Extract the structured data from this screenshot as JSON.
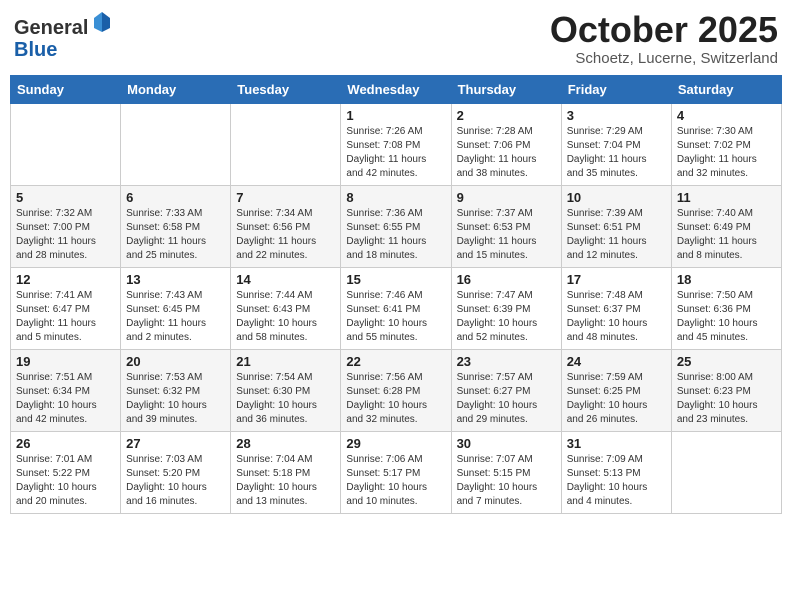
{
  "header": {
    "logo_general": "General",
    "logo_blue": "Blue",
    "month_title": "October 2025",
    "subtitle": "Schoetz, Lucerne, Switzerland"
  },
  "days_of_week": [
    "Sunday",
    "Monday",
    "Tuesday",
    "Wednesday",
    "Thursday",
    "Friday",
    "Saturday"
  ],
  "weeks": [
    [
      {
        "day": "",
        "info": ""
      },
      {
        "day": "",
        "info": ""
      },
      {
        "day": "",
        "info": ""
      },
      {
        "day": "1",
        "info": "Sunrise: 7:26 AM\nSunset: 7:08 PM\nDaylight: 11 hours and 42 minutes."
      },
      {
        "day": "2",
        "info": "Sunrise: 7:28 AM\nSunset: 7:06 PM\nDaylight: 11 hours and 38 minutes."
      },
      {
        "day": "3",
        "info": "Sunrise: 7:29 AM\nSunset: 7:04 PM\nDaylight: 11 hours and 35 minutes."
      },
      {
        "day": "4",
        "info": "Sunrise: 7:30 AM\nSunset: 7:02 PM\nDaylight: 11 hours and 32 minutes."
      }
    ],
    [
      {
        "day": "5",
        "info": "Sunrise: 7:32 AM\nSunset: 7:00 PM\nDaylight: 11 hours and 28 minutes."
      },
      {
        "day": "6",
        "info": "Sunrise: 7:33 AM\nSunset: 6:58 PM\nDaylight: 11 hours and 25 minutes."
      },
      {
        "day": "7",
        "info": "Sunrise: 7:34 AM\nSunset: 6:56 PM\nDaylight: 11 hours and 22 minutes."
      },
      {
        "day": "8",
        "info": "Sunrise: 7:36 AM\nSunset: 6:55 PM\nDaylight: 11 hours and 18 minutes."
      },
      {
        "day": "9",
        "info": "Sunrise: 7:37 AM\nSunset: 6:53 PM\nDaylight: 11 hours and 15 minutes."
      },
      {
        "day": "10",
        "info": "Sunrise: 7:39 AM\nSunset: 6:51 PM\nDaylight: 11 hours and 12 minutes."
      },
      {
        "day": "11",
        "info": "Sunrise: 7:40 AM\nSunset: 6:49 PM\nDaylight: 11 hours and 8 minutes."
      }
    ],
    [
      {
        "day": "12",
        "info": "Sunrise: 7:41 AM\nSunset: 6:47 PM\nDaylight: 11 hours and 5 minutes."
      },
      {
        "day": "13",
        "info": "Sunrise: 7:43 AM\nSunset: 6:45 PM\nDaylight: 11 hours and 2 minutes."
      },
      {
        "day": "14",
        "info": "Sunrise: 7:44 AM\nSunset: 6:43 PM\nDaylight: 10 hours and 58 minutes."
      },
      {
        "day": "15",
        "info": "Sunrise: 7:46 AM\nSunset: 6:41 PM\nDaylight: 10 hours and 55 minutes."
      },
      {
        "day": "16",
        "info": "Sunrise: 7:47 AM\nSunset: 6:39 PM\nDaylight: 10 hours and 52 minutes."
      },
      {
        "day": "17",
        "info": "Sunrise: 7:48 AM\nSunset: 6:37 PM\nDaylight: 10 hours and 48 minutes."
      },
      {
        "day": "18",
        "info": "Sunrise: 7:50 AM\nSunset: 6:36 PM\nDaylight: 10 hours and 45 minutes."
      }
    ],
    [
      {
        "day": "19",
        "info": "Sunrise: 7:51 AM\nSunset: 6:34 PM\nDaylight: 10 hours and 42 minutes."
      },
      {
        "day": "20",
        "info": "Sunrise: 7:53 AM\nSunset: 6:32 PM\nDaylight: 10 hours and 39 minutes."
      },
      {
        "day": "21",
        "info": "Sunrise: 7:54 AM\nSunset: 6:30 PM\nDaylight: 10 hours and 36 minutes."
      },
      {
        "day": "22",
        "info": "Sunrise: 7:56 AM\nSunset: 6:28 PM\nDaylight: 10 hours and 32 minutes."
      },
      {
        "day": "23",
        "info": "Sunrise: 7:57 AM\nSunset: 6:27 PM\nDaylight: 10 hours and 29 minutes."
      },
      {
        "day": "24",
        "info": "Sunrise: 7:59 AM\nSunset: 6:25 PM\nDaylight: 10 hours and 26 minutes."
      },
      {
        "day": "25",
        "info": "Sunrise: 8:00 AM\nSunset: 6:23 PM\nDaylight: 10 hours and 23 minutes."
      }
    ],
    [
      {
        "day": "26",
        "info": "Sunrise: 7:01 AM\nSunset: 5:22 PM\nDaylight: 10 hours and 20 minutes."
      },
      {
        "day": "27",
        "info": "Sunrise: 7:03 AM\nSunset: 5:20 PM\nDaylight: 10 hours and 16 minutes."
      },
      {
        "day": "28",
        "info": "Sunrise: 7:04 AM\nSunset: 5:18 PM\nDaylight: 10 hours and 13 minutes."
      },
      {
        "day": "29",
        "info": "Sunrise: 7:06 AM\nSunset: 5:17 PM\nDaylight: 10 hours and 10 minutes."
      },
      {
        "day": "30",
        "info": "Sunrise: 7:07 AM\nSunset: 5:15 PM\nDaylight: 10 hours and 7 minutes."
      },
      {
        "day": "31",
        "info": "Sunrise: 7:09 AM\nSunset: 5:13 PM\nDaylight: 10 hours and 4 minutes."
      },
      {
        "day": "",
        "info": ""
      }
    ]
  ]
}
